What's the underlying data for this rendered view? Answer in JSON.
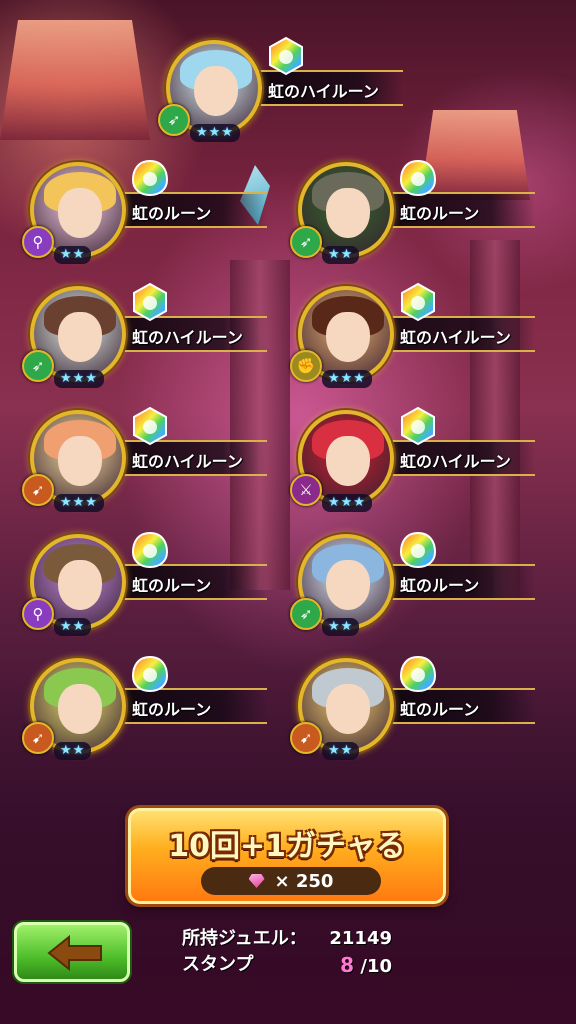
{
  "rewards": [
    {
      "label": "虹のハイルーン",
      "stars": "★★★",
      "element_icon": "leaf-icon",
      "element_glyph": "➶",
      "element_color": "#2fa84a",
      "hair_color": "#9fd8ee",
      "bg_color": "#d9f0f6",
      "rune": "high"
    },
    {
      "label": "虹のルーン",
      "stars": "★★",
      "element_icon": "staff-icon",
      "element_glyph": "⚲",
      "element_color": "#8a3cc0",
      "hair_color": "#f2c45a",
      "bg_color": "#f4d0e8",
      "rune": "normal"
    },
    {
      "label": "虹のルーン",
      "stars": "★★",
      "element_icon": "leaf-icon",
      "element_glyph": "➶",
      "element_color": "#2fa84a",
      "hair_color": "#6a6a5a",
      "bg_color": "#2f6a2a",
      "rune": "normal"
    },
    {
      "label": "虹のハイルーン",
      "stars": "★★★",
      "element_icon": "leaf-icon",
      "element_glyph": "➶",
      "element_color": "#2fa84a",
      "hair_color": "#6a4030",
      "bg_color": "#e0f0e8",
      "rune": "high"
    },
    {
      "label": "虹のハイルーン",
      "stars": "★★★",
      "element_icon": "fist-icon",
      "element_glyph": "✊",
      "element_color": "#9a8a20",
      "hair_color": "#5a2818",
      "bg_color": "#e8b070",
      "rune": "high"
    },
    {
      "label": "虹のハイルーン",
      "stars": "★★★",
      "element_icon": "bow-icon",
      "element_glyph": "➹",
      "element_color": "#c85a20",
      "hair_color": "#f0a070",
      "bg_color": "#f6e0a0",
      "rune": "high"
    },
    {
      "label": "虹のハイルーン",
      "stars": "★★★",
      "element_icon": "sword-icon",
      "element_glyph": "⚔",
      "element_color": "#8a2a8a",
      "hair_color": "#d83040",
      "bg_color": "#c82030",
      "rune": "high"
    },
    {
      "label": "虹のルーン",
      "stars": "★★",
      "element_icon": "staff-icon",
      "element_glyph": "⚲",
      "element_color": "#8a3cc0",
      "hair_color": "#7a5a3a",
      "bg_color": "#c08ae0",
      "rune": "normal"
    },
    {
      "label": "虹のルーン",
      "stars": "★★",
      "element_icon": "leaf-icon",
      "element_glyph": "➶",
      "element_color": "#2fa84a",
      "hair_color": "#8ab6e0",
      "bg_color": "#e0f0ff",
      "rune": "normal"
    },
    {
      "label": "虹のルーン",
      "stars": "★★",
      "element_icon": "bow-icon",
      "element_glyph": "➹",
      "element_color": "#c85a20",
      "hair_color": "#8ac850",
      "bg_color": "#e8e070",
      "rune": "normal"
    },
    {
      "label": "虹のルーン",
      "stars": "★★",
      "element_icon": "bow-icon",
      "element_glyph": "➹",
      "element_color": "#c85a20",
      "hair_color": "#c0c8d0",
      "bg_color": "#f0d070",
      "rune": "normal"
    }
  ],
  "gacha_button": {
    "label": "10回+1ガチャる",
    "cost_multiplier": "× 250"
  },
  "back_button_icon": "back-arrow-icon",
  "info": {
    "jewel_label": "所持ジュエル：",
    "jewel_value": "21149",
    "stamp_label": "スタンプ",
    "stamp_current": "8",
    "stamp_total": "/10"
  }
}
